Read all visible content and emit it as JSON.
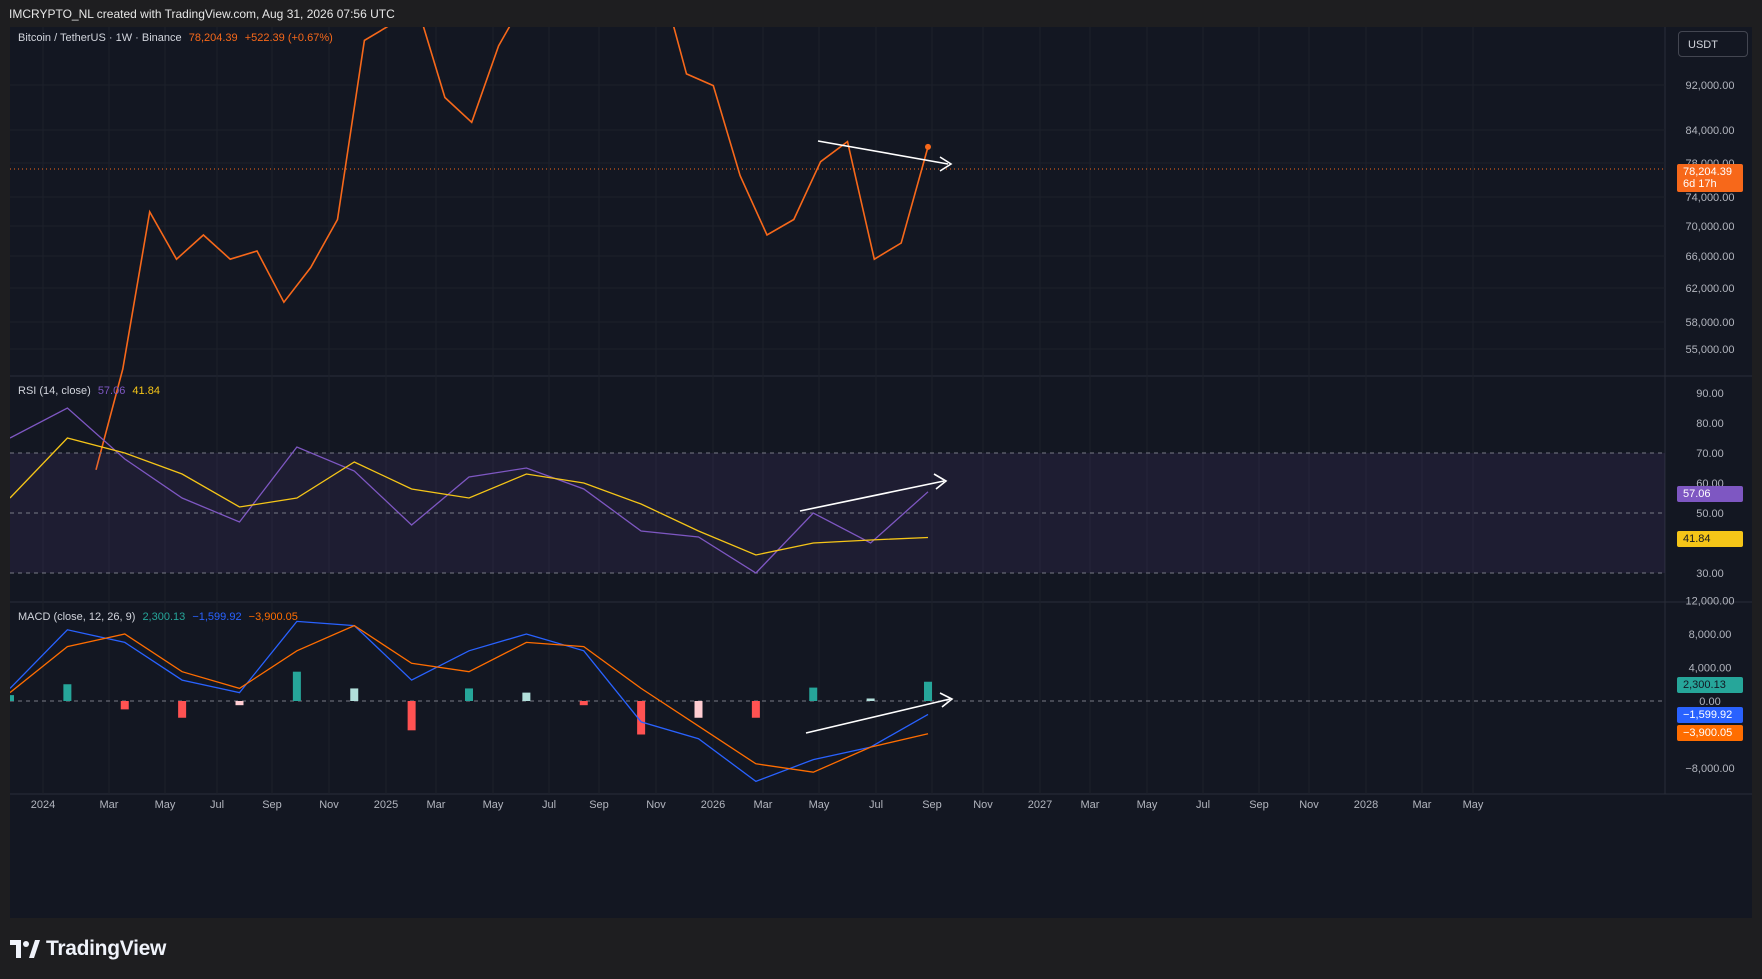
{
  "header": {
    "text": "IMCRYPTO_NL created with TradingView.com, Aug 31, 2026 07:56 UTC"
  },
  "footer": {
    "brand": "TradingView",
    "icon": "tradingview-logo-icon"
  },
  "price_pane": {
    "legend": {
      "symbol": "Bitcoin / TetherUS · 1W · Binance",
      "last": "78,204.39",
      "change": "+522.39 (+0.67%)"
    },
    "currency_button": "USDT",
    "last_badge": {
      "price": "78,204.39",
      "countdown": "6d 17h"
    },
    "axis_labels": [
      "92,000.00",
      "84,000.00",
      "78,000.00",
      "74,000.00",
      "70,000.00",
      "66,000.00",
      "62,000.00",
      "58,000.00",
      "55,000.00"
    ]
  },
  "rsi_pane": {
    "legend": {
      "name": "RSI (14, close)",
      "rsi": "57.06",
      "ma": "41.84"
    },
    "badges": {
      "rsi": "57.06",
      "ma": "41.84"
    },
    "axis_labels": [
      "90.00",
      "80.00",
      "70.00",
      "60.00",
      "50.00",
      "40.00",
      "30.00"
    ]
  },
  "macd_pane": {
    "legend": {
      "name": "MACD (close, 12, 26, 9)",
      "hist": "2,300.13",
      "macd": "−1,599.92",
      "signal": "−3,900.05"
    },
    "badges": {
      "hist": "2,300.13",
      "macd": "−1,599.92",
      "signal": "−3,900.05"
    },
    "axis_labels": [
      "12,000.00",
      "8,000.00",
      "4,000.00",
      "0.00",
      "−8,000.00"
    ]
  },
  "time_axis": {
    "labels": [
      "2024",
      "Mar",
      "May",
      "Jul",
      "Sep",
      "Nov",
      "2025",
      "Mar",
      "May",
      "Jul",
      "Sep",
      "Nov",
      "2026",
      "Mar",
      "May",
      "Jul",
      "Sep",
      "Nov",
      "2027",
      "Mar",
      "May",
      "Jul",
      "Sep",
      "Nov",
      "2028",
      "Mar",
      "May"
    ]
  },
  "colors": {
    "background": "#131722",
    "price_line": "#f7681a",
    "rsi_line": "#7e57c2",
    "rsi_ma": "#f5c518",
    "macd_line": "#2962ff",
    "signal_line": "#ff6d00",
    "hist_up_strong": "#26a69a",
    "hist_up_weak": "#b2dfdb",
    "hist_down_strong": "#ff5252",
    "hist_down_weak": "#ffcdd2",
    "annotation": "#ffffff"
  },
  "chart_data": [
    {
      "type": "line",
      "title": "Bitcoin / TetherUS · 1W · Binance",
      "x": [
        "2024-01",
        "2024-02",
        "2024-03",
        "2024-04",
        "2024-05",
        "2024-06",
        "2024-07",
        "2024-08",
        "2024-09",
        "2024-10",
        "2024-11",
        "2024-12",
        "2025-01",
        "2025-02",
        "2025-03",
        "2025-04",
        "2025-05",
        "2025-06",
        "2025-07",
        "2025-08",
        "2025-09",
        "2025-10",
        "2025-11",
        "2025-12",
        "2026-01",
        "2026-02",
        "2026-03",
        "2026-04",
        "2026-05",
        "2026-06",
        "2026-07",
        "2026-08"
      ],
      "series": [
        {
          "name": "Bitcoin / TetherUS",
          "values": [
            42000,
            51000,
            69000,
            63000,
            66000,
            63000,
            64000,
            58000,
            62000,
            68000,
            96000,
            99000,
            102000,
            86000,
            82000,
            95000,
            104000,
            107000,
            117000,
            115000,
            112000,
            109000,
            90000,
            88000,
            74000,
            66000,
            68000,
            76000,
            79000,
            63000,
            65000,
            78204
          ]
        }
      ],
      "ylim": [
        53000,
        97000
      ]
    },
    {
      "type": "line",
      "title": "RSI (14, close)",
      "x": [
        "2024-01",
        "2024-03",
        "2024-05",
        "2024-07",
        "2024-09",
        "2024-11",
        "2025-01",
        "2025-03",
        "2025-05",
        "2025-07",
        "2025-09",
        "2025-11",
        "2026-01",
        "2026-03",
        "2026-05",
        "2026-07",
        "2026-08"
      ],
      "series": [
        {
          "name": "RSI",
          "values": [
            75,
            85,
            68,
            55,
            47,
            72,
            64,
            46,
            62,
            65,
            58,
            44,
            42,
            30,
            50,
            40,
            57.06
          ]
        },
        {
          "name": "RSI MA",
          "values": [
            55,
            75,
            70,
            63,
            52,
            55,
            67,
            58,
            55,
            63,
            60,
            53,
            44,
            36,
            40,
            41,
            41.84
          ]
        }
      ],
      "ylim": [
        26,
        96
      ]
    },
    {
      "type": "bar",
      "title": "MACD (close, 12, 26, 9)",
      "x": [
        "2024-01",
        "2024-03",
        "2024-05",
        "2024-07",
        "2024-09",
        "2024-11",
        "2025-01",
        "2025-03",
        "2025-05",
        "2025-07",
        "2025-09",
        "2025-11",
        "2026-01",
        "2026-03",
        "2026-05",
        "2026-07",
        "2026-08"
      ],
      "series": [
        {
          "name": "MACD",
          "values": [
            1500,
            8500,
            7000,
            2500,
            1000,
            9500,
            9000,
            2500,
            6000,
            8000,
            6000,
            -2500,
            -4500,
            -9600,
            -7000,
            -5500,
            -1599.92
          ]
        },
        {
          "name": "Signal",
          "values": [
            1000,
            6500,
            8000,
            3500,
            1500,
            6000,
            9000,
            4500,
            3500,
            7000,
            6500,
            1500,
            -3000,
            -7500,
            -8500,
            -5500,
            -3900.05
          ]
        },
        {
          "name": "Histogram",
          "values": [
            700,
            2000,
            -1000,
            -2000,
            -500,
            3500,
            1500,
            -3500,
            1500,
            1000,
            -500,
            -4000,
            -2000,
            -2000,
            1600,
            300,
            2300.13
          ]
        }
      ],
      "ylim": [
        -12000,
        13000
      ]
    }
  ]
}
